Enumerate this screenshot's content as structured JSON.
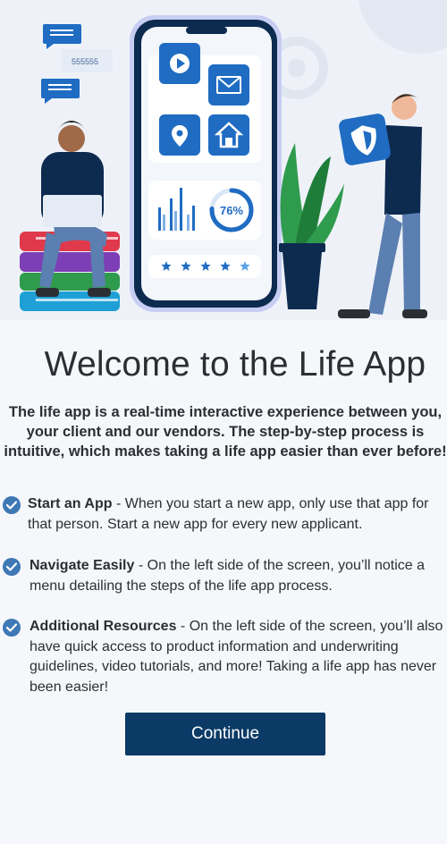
{
  "hero": {
    "chat_number": "555555",
    "progress_label": "76%",
    "progress_fraction": 0.76,
    "rating_stars": 5,
    "colors": {
      "primary_blue": "#1f6cc2",
      "navy": "#0d2a4f",
      "accent_red": "#e0394b",
      "green": "#2e9b4d"
    }
  },
  "welcome": {
    "title": "Welcome to the Life App",
    "intro": "The life app is a real-time interactive experience between you, your client and our vendors. The step-by-step process is intuitive, which makes taking a life app easier than ever before!"
  },
  "features": [
    {
      "icon": "check-circle-icon",
      "title": "Start an App",
      "description": " - When you start a new app, only use that app for that person. Start a new app for every new applicant."
    },
    {
      "icon": "check-circle-icon",
      "title": "Navigate Easily",
      "description": " - On the left side of the screen, you’ll notice a menu detailing the steps of the life app process."
    },
    {
      "icon": "check-circle-icon",
      "title": "Additional Resources",
      "description": " - On the left side of the screen, you’ll also have quick access to product information and underwriting guidelines, video tutorials, and more! Taking a life app has never been easier!"
    }
  ],
  "actions": {
    "continue_label": "Continue",
    "button_color": "#0b3a66"
  }
}
